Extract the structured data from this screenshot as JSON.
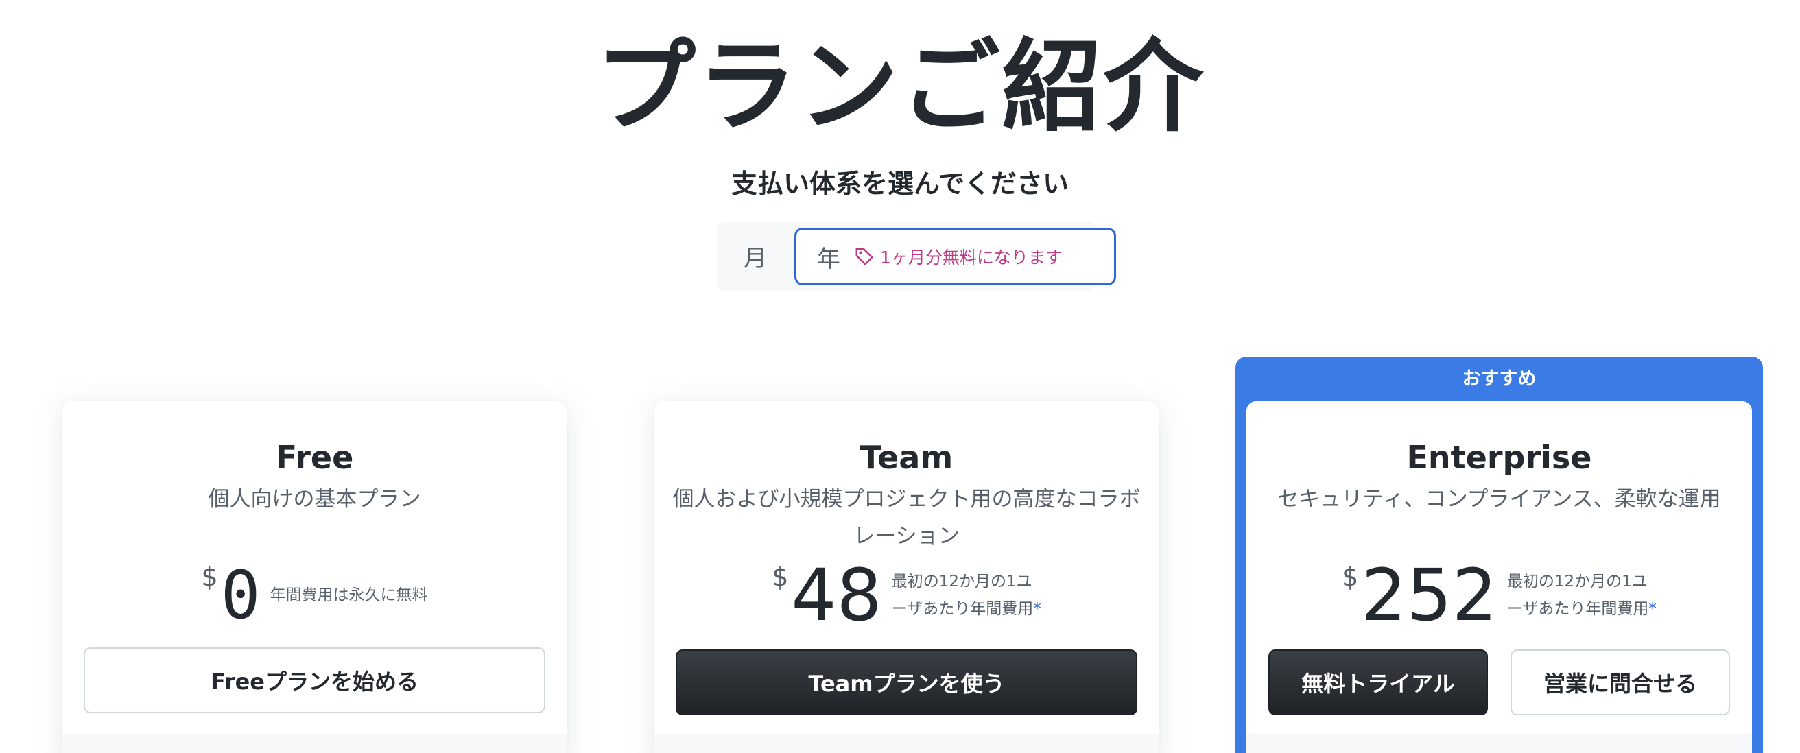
{
  "header": {
    "title": "プランご紹介",
    "billing_label": "支払い体系を選んでください"
  },
  "billing_toggle": {
    "month_label": "月",
    "year_label": "年",
    "discount_label": "1ヶ月分無料になります",
    "selected": "年"
  },
  "plans": [
    {
      "name": "Free",
      "description": "個人向けの基本プラン",
      "currency": "$",
      "price": "0",
      "price_note": "年間費用は永久に無料",
      "cta_label": "Freeプランを始める"
    },
    {
      "name": "Team",
      "description": "個人および小規模プロジェクト用の高度なコラボレーション",
      "currency": "$",
      "price": "48",
      "price_note_line1": "最初の12か月の1ユ",
      "price_note_line2": "ーザあたり年間費用",
      "asterisk": "*",
      "cta_label": "Teamプランを使う"
    },
    {
      "name": "Enterprise",
      "recommended_badge": "おすすめ",
      "description": "セキュリティ、コンプライアンス、柔軟な運用",
      "currency": "$",
      "price": "252",
      "price_note_line1": "最初の12か月の1ユ",
      "price_note_line2": "ーザあたり年間費用",
      "asterisk": "*",
      "trial_label": "無料トライアル",
      "contact_label": "営業に問合せる"
    }
  ],
  "colors": {
    "accent_blue": "#3b7be6",
    "discount_pink": "#bf3989",
    "text_dark": "#24292f",
    "text_muted": "#57606a"
  },
  "icons": {
    "discount": "tag-icon"
  }
}
